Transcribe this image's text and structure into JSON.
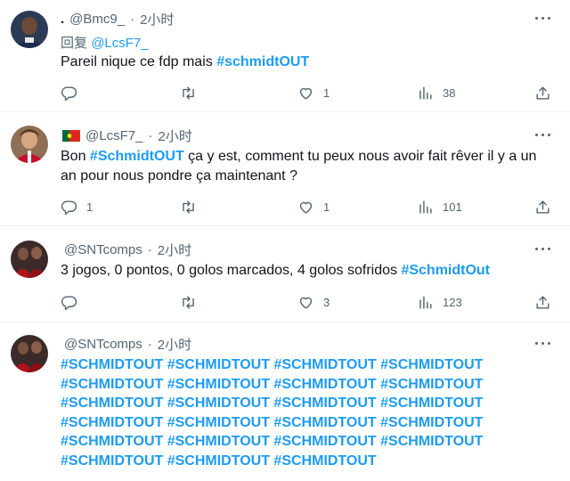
{
  "tweets": [
    {
      "display_name": ".",
      "handle": "@Bmc9_",
      "sep": "·",
      "time": "2小时",
      "reply_label": "回复",
      "reply_handle": "@LcsF7_",
      "text_plain": "Pareil nique ce fdp mais ",
      "text_hashtag": "#schmidtOUT",
      "reply_count": "",
      "like_count": "1",
      "view_count": "38"
    },
    {
      "handle": "@LcsF7_",
      "sep": "·",
      "time": "2小时",
      "flag_colors": [
        "#046a38",
        "#da291c"
      ],
      "text_lead": "Bon ",
      "text_hashtag": "#SchmidtOUT",
      "text_line1_rest": " ça y est, comment tu peux nous avoir fait rêver il y a un",
      "text_line2": "an pour nous pondre ça maintenant ?",
      "reply_count": "1",
      "like_count": "1",
      "view_count": "101"
    },
    {
      "handle": "@SNTcomps",
      "sep": "·",
      "time": "2小时",
      "text_plain": "3 jogos, 0 pontos, 0 golos marcados, 4 golos sofridos ",
      "text_hashtag": "#SchmidtOut",
      "like_count": "3",
      "view_count": "123"
    },
    {
      "handle": "@SNTcomps",
      "sep": "·",
      "time": "2小时",
      "hashtag_lines": [
        "#SCHMIDTOUT #SCHMIDTOUT #SCHMIDTOUT #SCHMIDTOUT",
        "#SCHMIDTOUT #SCHMIDTOUT #SCHMIDTOUT #SCHMIDTOUT",
        "#SCHMIDTOUT #SCHMIDTOUT #SCHMIDTOUT #SCHMIDTOUT",
        "#SCHMIDTOUT #SCHMIDTOUT #SCHMIDTOUT #SCHMIDTOUT",
        "#SCHMIDTOUT #SCHMIDTOUT #SCHMIDTOUT #SCHMIDTOUT",
        "#SCHMIDTOUT #SCHMIDTOUT #SCHMIDTOUT"
      ]
    }
  ],
  "colors": {
    "accent": "#1d9bf0",
    "text": "#0f1419",
    "muted": "#536471",
    "divider": "#eff3f4"
  },
  "icons": [
    "reply-icon",
    "retweet-icon",
    "like-icon",
    "views-icon",
    "share-icon",
    "more-icon"
  ]
}
